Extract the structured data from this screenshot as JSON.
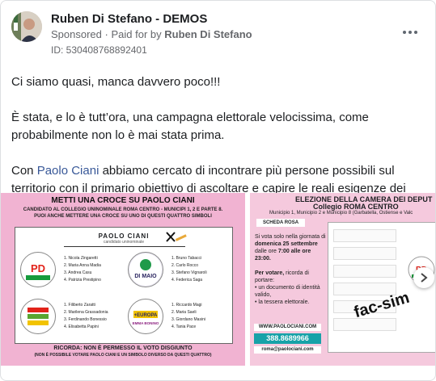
{
  "post": {
    "author": "Ruben Di Stefano - DEMOS",
    "sponsored": "Sponsored",
    "paid_prefix": "Paid for by",
    "paid_by": "Ruben Di Stefano",
    "ad_id": "ID: 530408768892401",
    "p1": "Ci siamo quasi, manca davvero poco!!!",
    "p2": "È stata, e lo è tutt’ora, una campagna elettorale velocissima, come probabilmente non lo è mai stata prima.",
    "p3_pre": "Con ",
    "p3_link": "Paolo Ciani",
    "p3_post": " abbiamo cercato di incontrare più persone possibili sul territorio con il primario obiettivo di ascoltare e capire le reali esigenze dei cittadini, spess…"
  },
  "creative1": {
    "headline": "METTI UNA CROCE SU PAOLO CIANI",
    "sub1": "CANDIDATO AL COLLEGIO UNINOMINALE ROMA CENTRO - MUNICIPI 1, 2 E PARTE 8.",
    "sub2": "PUOI ANCHE METTERE UNA CROCE SU UNO DI QUESTI QUATTRO SIMBOLI",
    "candidate": "PAOLO CIANI",
    "candidate_sub": "candidato uninominale",
    "lists": [
      {
        "logo_text": "PD",
        "logo_sub": "ITALIA DEMOCRATICA E PROGRESSISTA",
        "names": [
          "1. Nicola Zingaretti",
          "2. Maria Anna Madia",
          "3. Andrea Casu",
          "4. Patrizia Prestipino"
        ],
        "color": "#e2231a"
      },
      {
        "logo_text": "IMPEGNO CIVICO",
        "logo_sub": "DI MAIO",
        "names": [
          "1. Bruno Tabacci",
          "2. Carlo Rocco",
          "3. Stefano Vignaroli",
          "4. Federica Saga"
        ],
        "color": "#2a2560"
      },
      {
        "logo_text": "Alleanza Verdi Sinistra",
        "logo_sub": "",
        "names": [
          "1. Filiberto Zaratti",
          "2. Marilena Grassadonia",
          "3. Ferdinando Bonessio",
          "4. Elisabetta Papini"
        ],
        "color": "#5aa531"
      },
      {
        "logo_text": "+EUROPA",
        "logo_sub": "EMMA BONINO",
        "names": [
          "1. Riccardo Magi",
          "2. Maria Saeli",
          "3. Giordano Masini",
          "4. Tania Pace"
        ],
        "color": "#f2c300"
      }
    ],
    "ricorda": "RICORDA: NON È PERMESSO IL VOTO DISGIUNTO",
    "ricorda_sub": "(NON È POSSIBILE VOTARE PAOLO CIANI E UN SIMBOLO DIVERSO DA QUESTI QUATTRO)"
  },
  "creative2": {
    "title1": "ELEZIONE DELLA CAMERA DEI DEPUT",
    "title2": "Collegio ROMA CENTRO",
    "title3": "Municipio 1, Municipio 2 e Municipio 8 (Garbatella, Ostiense e Valc",
    "scheda": "SCHEDA ROSA",
    "v1": "Si vota solo nella giornata di",
    "v_day": "domenica 25 settembre",
    "v2": "dalle ore",
    "v_time": "7:00 alle ore 23:00.",
    "v3": "Per votare,",
    "v4": "ricorda di portare:",
    "b1": "un documento di identità valido,",
    "b2": "la tessera elettorale.",
    "site": "WWW.PAOLOCIANI.COM",
    "phone": "388.8689966",
    "email": "roma@paolociani.com",
    "facsimile": "fac-sim"
  }
}
